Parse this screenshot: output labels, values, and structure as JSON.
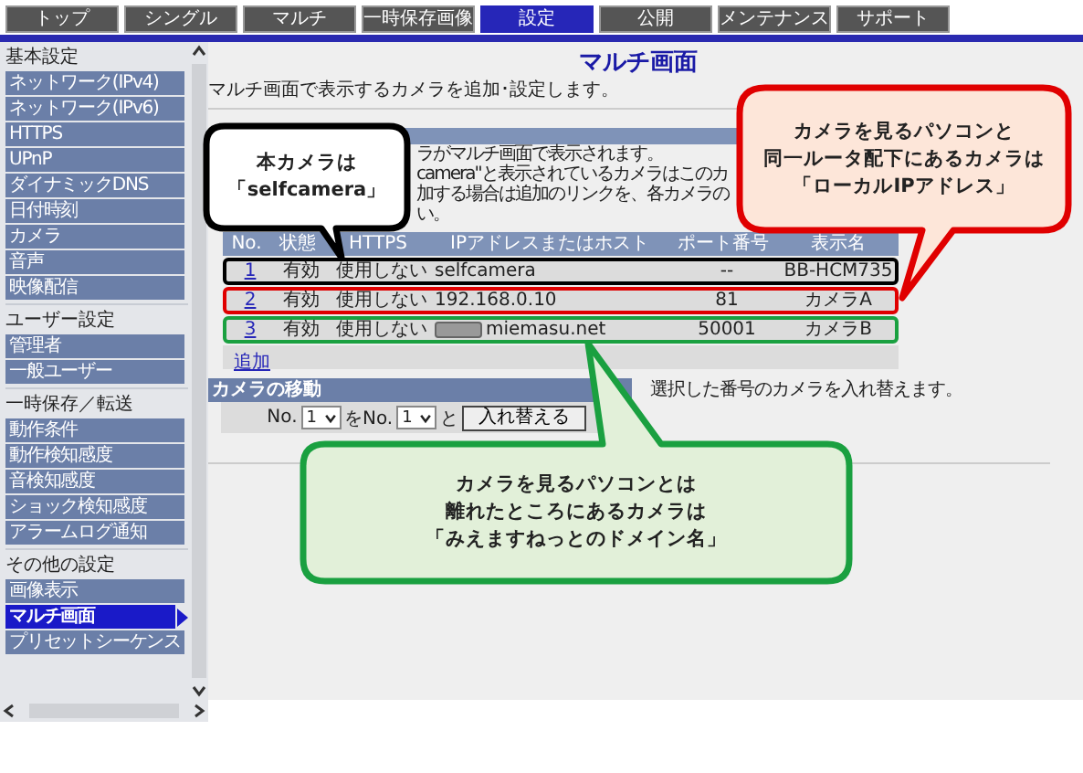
{
  "nav_tabs": [
    {
      "label": "トップ",
      "selected": false
    },
    {
      "label": "シングル",
      "selected": false
    },
    {
      "label": "マルチ",
      "selected": false
    },
    {
      "label": "一時保存画像",
      "selected": false
    },
    {
      "label": "設定",
      "selected": true
    },
    {
      "label": "公開",
      "selected": false
    },
    {
      "label": "メンテナンス",
      "selected": false
    },
    {
      "label": "サポート",
      "selected": false
    }
  ],
  "sidebar": {
    "sections": [
      {
        "heading": "基本設定",
        "items": [
          {
            "label": "ネットワーク(IPv4)",
            "selected": false
          },
          {
            "label": "ネットワーク(IPv6)",
            "selected": false
          },
          {
            "label": "HTTPS",
            "selected": false
          },
          {
            "label": "UPnP",
            "selected": false
          },
          {
            "label": "ダイナミックDNS",
            "selected": false
          },
          {
            "label": "日付時刻",
            "selected": false
          },
          {
            "label": "カメラ",
            "selected": false
          },
          {
            "label": "音声",
            "selected": false
          },
          {
            "label": "映像配信",
            "selected": false
          }
        ]
      },
      {
        "heading": "ユーザー設定",
        "items": [
          {
            "label": "管理者",
            "selected": false
          },
          {
            "label": "一般ユーザー",
            "selected": false
          }
        ]
      },
      {
        "heading": "一時保存／転送",
        "items": [
          {
            "label": "動作条件",
            "selected": false
          },
          {
            "label": "動作検知感度",
            "selected": false
          },
          {
            "label": "音検知感度",
            "selected": false
          },
          {
            "label": "ショック検知感度",
            "selected": false
          },
          {
            "label": "アラームログ通知",
            "selected": false
          }
        ]
      },
      {
        "heading": "その他の設定",
        "items": [
          {
            "label": "画像表示",
            "selected": false
          },
          {
            "label": "マルチ画面",
            "selected": true
          },
          {
            "label": "プリセットシーケンス",
            "selected": false
          }
        ]
      }
    ]
  },
  "page": {
    "title": "マルチ画面",
    "description": "マルチ画面で表示するカメラを追加･設定します。",
    "info_lines": [
      "ラがマルチ画面で表示されます。",
      "camera\"と表示されているカメラはこのカ",
      "加する場合は追加のリンクを、各カメラの",
      "い。"
    ],
    "table": {
      "columns": [
        "No.",
        "状態",
        "HTTPS",
        "IPアドレスまたはホスト",
        "ポート番号",
        "表示名"
      ],
      "rows": [
        {
          "no": "1",
          "status": "有効",
          "https": "使用しない",
          "host": "selfcamera",
          "host_redacted": false,
          "port": "--",
          "name": "BB-HCM735",
          "color": "#000000"
        },
        {
          "no": "2",
          "status": "有効",
          "https": "使用しない",
          "host": "192.168.0.10",
          "host_redacted": false,
          "port": "81",
          "name": "カメラA",
          "color": "#e00000"
        },
        {
          "no": "3",
          "status": "有効",
          "https": "使用しない",
          "host": "miemasu.net",
          "host_redacted": true,
          "port": "50001",
          "name": "カメラB",
          "color": "#1aa040"
        }
      ],
      "add_link": "追加"
    },
    "move": {
      "heading": "カメラの移動",
      "note": "選択した番号のカメラを入れ替えます。",
      "label_from": "No.",
      "from_value": "1",
      "label_to": "をNo.",
      "to_value": "1",
      "label_and": "と",
      "button": "入れ替える"
    }
  },
  "callouts": [
    {
      "color": "#000000",
      "lines": [
        "本カメラは",
        "「selfcamera」"
      ]
    },
    {
      "color": "#e00000",
      "lines": [
        "カメラを見るパソコンと",
        "同一ルータ配下にあるカメラは",
        "「ローカルIPアドレス」"
      ]
    },
    {
      "color": "#1aa040",
      "lines": [
        "カメラを見るパソコンとは",
        "離れたところにあるカメラは",
        "「みえますねっとのドメイン名」"
      ]
    }
  ]
}
